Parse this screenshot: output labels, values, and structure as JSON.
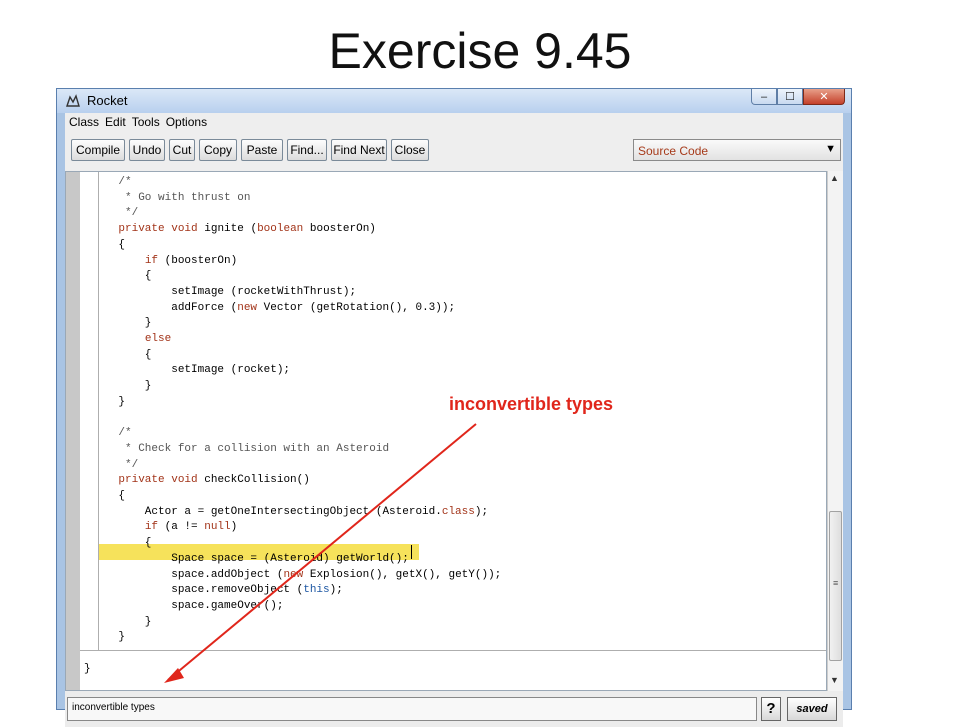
{
  "slide": {
    "title": "Exercise 9.45"
  },
  "window": {
    "title": "Rocket",
    "min_symbol": "–",
    "max_symbol": "☐",
    "close_symbol": "✕"
  },
  "menu": [
    "Class",
    "Edit",
    "Tools",
    "Options"
  ],
  "toolbar": [
    "Compile",
    "Undo",
    "Cut",
    "Copy",
    "Paste",
    "Find...",
    "Find Next",
    "Close"
  ],
  "view_select": {
    "value": "Source Code",
    "arrow": "▼"
  },
  "code": [
    "    /*",
    "     * Go with thrust on",
    "     */",
    "    private void ignite (boolean boosterOn)",
    "    {",
    "        if (boosterOn)",
    "        {",
    "            setImage (rocketWithThrust);",
    "            addForce (new Vector (getRotation(), 0.3));",
    "        }",
    "        else",
    "        {",
    "            setImage (rocket);",
    "        }",
    "    }",
    "",
    "    /*",
    "     * Check for a collision with an Asteroid",
    "     */",
    "    private void checkCollision()",
    "    {",
    "        Actor a = getOneIntersectingObject (Asteroid.class);",
    "        if (a != null)",
    "        {",
    "            Space space = (Asteroid) getWorld();",
    "            space.addObject (new Explosion(), getX(), getY());",
    "            space.removeObject (this);",
    "            space.gameOver();",
    "        }",
    "    }",
    "",
    "}"
  ],
  "highlighted_line": 24,
  "status": {
    "message": "inconvertible types",
    "help_label": "?",
    "saved_label": "saved"
  },
  "annotation": {
    "text": "inconvertible types",
    "color": "#e0261b"
  },
  "scrollbar": {
    "up": "▲",
    "down": "▼",
    "grip": "≡"
  }
}
